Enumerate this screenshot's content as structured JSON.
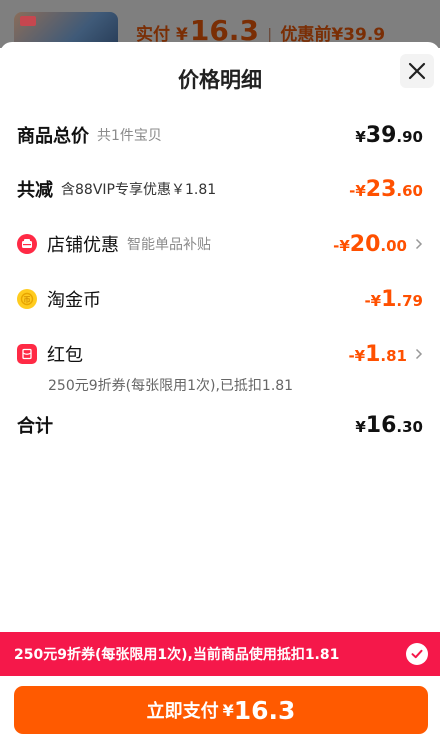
{
  "behind": {
    "paid_label": "实付",
    "paid_currency": "¥",
    "paid_value": "16.3",
    "before_label": "优惠前",
    "before_value": "¥39.9"
  },
  "sheet": {
    "title": "价格明细",
    "rows": {
      "total": {
        "label": "商品总价",
        "sub": "共1件宝贝",
        "currency": "¥",
        "int": "39",
        "dec": ".90"
      },
      "reduce": {
        "label": "共减",
        "sub": "含88VIP专享优惠￥1.81",
        "currency": "-¥",
        "int": "23",
        "dec": ".60"
      },
      "store": {
        "label": "店铺优惠",
        "sub": "智能单品补贴",
        "currency": "-¥",
        "int": "20",
        "dec": ".00"
      },
      "coins": {
        "label": "淘金币",
        "currency": "-¥",
        "int": "1",
        "dec": ".79"
      },
      "redpack": {
        "label": "红包",
        "currency": "-¥",
        "int": "1",
        "dec": ".81",
        "note": "250元9折券(每张限用1次),已抵扣1.81"
      },
      "sum": {
        "label": "合计",
        "currency": "¥",
        "int": "16",
        "dec": ".30"
      }
    }
  },
  "banner": {
    "text": "250元9折券(每张限用1次),当前商品使用抵扣1.81"
  },
  "pay_button": {
    "label": "立即支付",
    "currency": "¥",
    "value": "16.3"
  },
  "colors": {
    "accent": "#ff5000",
    "banner": "#f5184a",
    "button": "#ff5a00"
  }
}
